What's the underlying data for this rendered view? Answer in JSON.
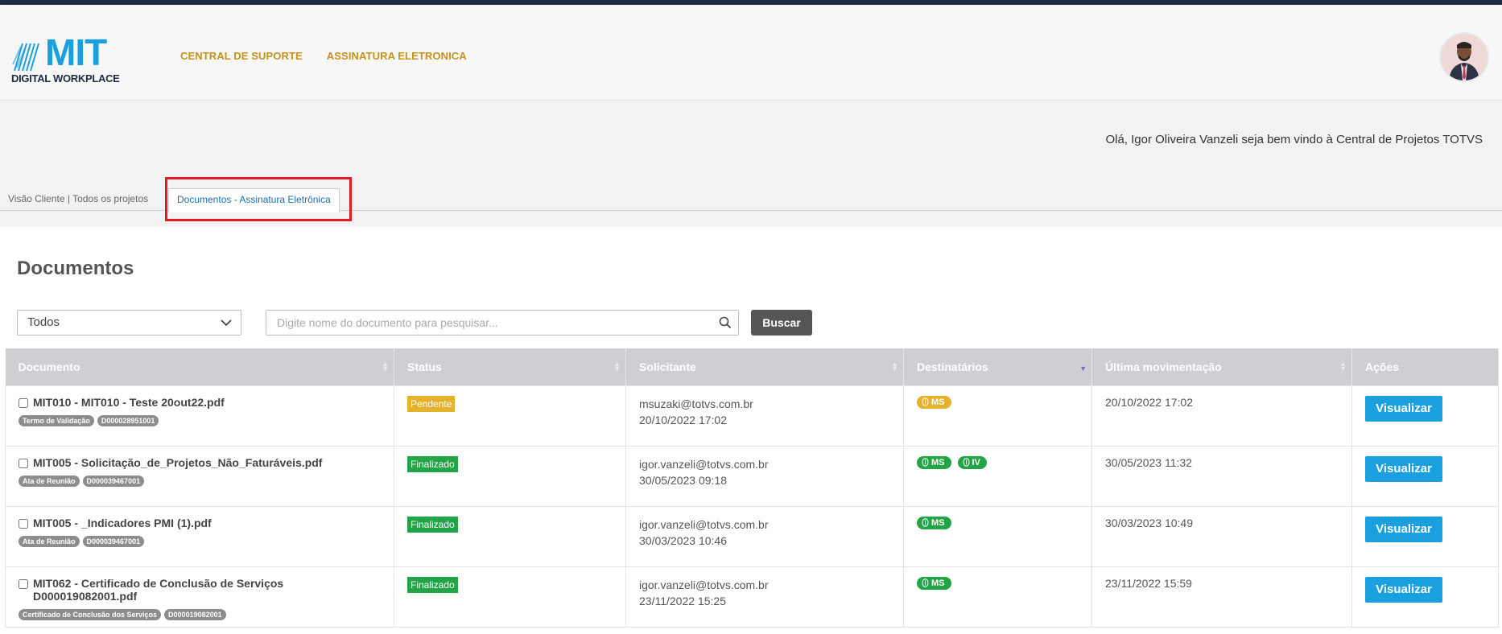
{
  "header": {
    "logo_main": "MIT",
    "logo_sub": "DIGITAL WORKPLACE",
    "nav": [
      "CENTRAL DE SUPORTE",
      "ASSINATURA ELETRONICA"
    ]
  },
  "greeting": "Olá, Igor Oliveira Vanzeli seja bem vindo à Central de Projetos TOTVS",
  "tabs": [
    "Visão Cliente | Todos os projetos",
    "Documentos - Assinatura Eletrônica"
  ],
  "page_title": "Documentos",
  "filters": {
    "select_value": "Todos",
    "search_placeholder": "Digite nome do documento para pesquisar...",
    "search_button": "Buscar"
  },
  "table": {
    "headers": [
      "Documento",
      "Status",
      "Solicitante",
      "Destinatários",
      "Última movimentação",
      "Ações"
    ],
    "rows": [
      {
        "doc": "MIT010 - MIT010 - Teste 20out22.pdf",
        "doc_line2": "",
        "tags": [
          "Termo de Validação",
          "D000028951001"
        ],
        "status": "Pendente",
        "email": "msuzaki@totvs.com.br",
        "req_date": "20/10/2022 17:02",
        "recipients": [
          "MS"
        ],
        "last_move": "20/10/2022 17:02",
        "action": "Visualizar"
      },
      {
        "doc": "MIT005 - Solicitação_de_Projetos_Não_Faturáveis.pdf",
        "doc_line2": "",
        "tags": [
          "Ata de Reunião",
          "D000039467001"
        ],
        "status": "Finalizado",
        "email": "igor.vanzeli@totvs.com.br",
        "req_date": "30/05/2023 09:18",
        "recipients": [
          "MS",
          "IV"
        ],
        "last_move": "30/05/2023 11:32",
        "action": "Visualizar"
      },
      {
        "doc": "MIT005 - _Indicadores PMI (1).pdf",
        "doc_line2": "",
        "tags": [
          "Ata de Reunião",
          "D000039467001"
        ],
        "status": "Finalizado",
        "email": "igor.vanzeli@totvs.com.br",
        "req_date": "30/03/2023 10:46",
        "recipients": [
          "MS"
        ],
        "last_move": "30/03/2023 10:49",
        "action": "Visualizar"
      },
      {
        "doc": "MIT062 - Certificado de Conclusão de Serviços",
        "doc_line2": "D000019082001.pdf",
        "tags": [
          "Certificado de Conclusão dos Serviços",
          "D000019082001"
        ],
        "status": "Finalizado",
        "email": "igor.vanzeli@totvs.com.br",
        "req_date": "23/11/2022 15:25",
        "recipients": [
          "MS"
        ],
        "last_move": "23/11/2022 15:59",
        "action": "Visualizar"
      }
    ]
  }
}
